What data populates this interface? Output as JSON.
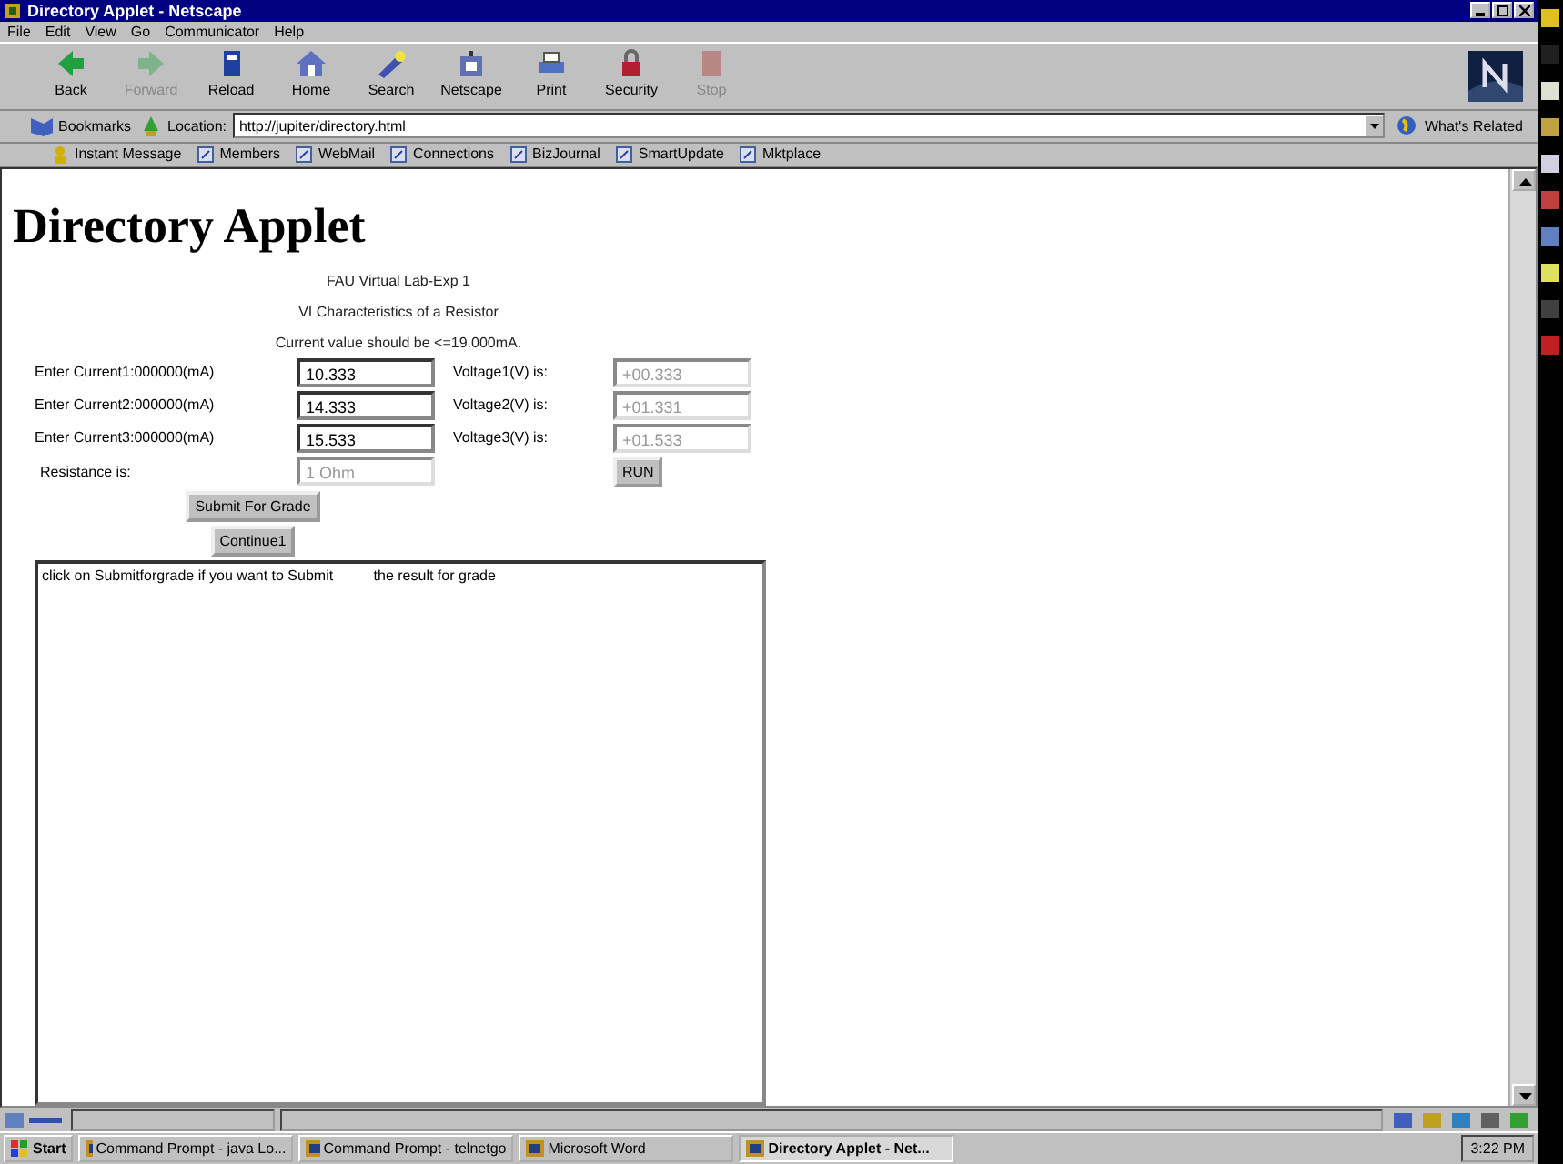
{
  "window": {
    "title": "Directory Applet - Netscape"
  },
  "menu": [
    "File",
    "Edit",
    "View",
    "Go",
    "Communicator",
    "Help"
  ],
  "toolbar": [
    {
      "kind": "back",
      "label": "Back",
      "disabled": false
    },
    {
      "kind": "forward",
      "label": "Forward",
      "disabled": true
    },
    {
      "kind": "reload",
      "label": "Reload",
      "disabled": false
    },
    {
      "kind": "home",
      "label": "Home",
      "disabled": false
    },
    {
      "kind": "search",
      "label": "Search",
      "disabled": false
    },
    {
      "kind": "netscape",
      "label": "Netscape",
      "disabled": false
    },
    {
      "kind": "print",
      "label": "Print",
      "disabled": false
    },
    {
      "kind": "security",
      "label": "Security",
      "disabled": false
    },
    {
      "kind": "stop",
      "label": "Stop",
      "disabled": true
    }
  ],
  "location": {
    "bookmarks": "Bookmarks",
    "label": "Location:",
    "value": "http://jupiter/directory.html",
    "related": "What's Related"
  },
  "personal_toolbar": [
    "Instant Message",
    "Members",
    "WebMail",
    "Connections",
    "BizJournal",
    "SmartUpdate",
    "Mktplace"
  ],
  "page": {
    "heading": "Directory Applet",
    "lines": [
      "FAU Virtual Lab-Exp 1",
      "VI Characteristics of a Resistor",
      "Current value should be <=19.000mA."
    ],
    "rows": [
      {
        "label": "Enter Current1:000000(mA)",
        "value": "10.333",
        "result_label": "Voltage1(V) is:",
        "result": "+00.333"
      },
      {
        "label": "Enter Current2:000000(mA)",
        "value": "14.333",
        "result_label": "Voltage2(V) is:",
        "result": "+01.331"
      },
      {
        "label": "Enter Current3:000000(mA)",
        "value": "15.533",
        "result_label": "Voltage3(V) is:",
        "result": "+01.533"
      }
    ],
    "resistance_label": "Resistance is:",
    "resistance": "1 Ohm",
    "run": "RUN",
    "submit": "Submit For Grade",
    "continue": "Continue1",
    "output": "click on Submitforgrade if you want to Submit          the result for grade"
  },
  "taskbar": {
    "start": "Start",
    "tasks": [
      {
        "label": "Command Prompt - java Lo...",
        "selected": false
      },
      {
        "label": "Command Prompt - telnetgo",
        "selected": false
      },
      {
        "label": "Microsoft Word",
        "selected": false
      },
      {
        "label": "Directory Applet - Net...",
        "selected": true
      }
    ],
    "clock": "3:22 PM"
  }
}
